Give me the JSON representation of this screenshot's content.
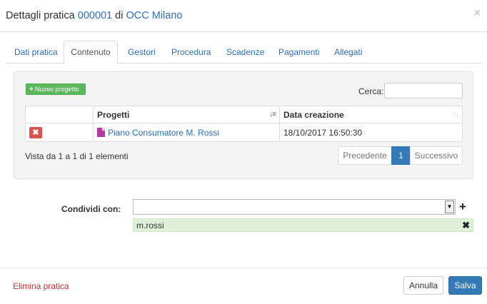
{
  "header": {
    "title_prefix": "Dettagli pratica ",
    "practice_id": "000001",
    "title_mid": " di ",
    "organization": "OCC Milano",
    "close_glyph": "×"
  },
  "tabs": [
    {
      "label": "Dati pratica",
      "active": false
    },
    {
      "label": "Contenuto",
      "active": true
    },
    {
      "label": "Gestori",
      "active": false
    },
    {
      "label": "Procedura",
      "active": false
    },
    {
      "label": "Scadenze",
      "active": false
    },
    {
      "label": "Pagamenti",
      "active": false
    },
    {
      "label": "Allegati",
      "active": false
    }
  ],
  "content": {
    "new_project_label": "Nuovo progetto",
    "search_label": "Cerca:",
    "search_value": "",
    "table": {
      "columns": [
        "",
        "Progetti",
        "Data creazione"
      ],
      "rows": [
        {
          "delete_glyph": "✖",
          "project": "Piano Consumatore M. Rossi",
          "created": "18/10/2017 16:50:30"
        }
      ]
    },
    "info_text": "Vista da 1 a 1 di 1 elementi",
    "pagination": {
      "previous": "Precedente",
      "current_page": "1",
      "next": "Successivo"
    }
  },
  "share": {
    "label": "Condividi con:",
    "select_value": "",
    "add_glyph": "+",
    "users": [
      {
        "name": "m.rossi",
        "remove_glyph": "✖"
      }
    ]
  },
  "footer": {
    "delete_label": "Elimina pratica",
    "cancel_label": "Annulla",
    "save_label": "Salva"
  },
  "colors": {
    "link": "#2a6ebb",
    "primary": "#337ab7",
    "success": "#5cb85c",
    "danger": "#d9534f",
    "chip_bg": "#dff0d8"
  }
}
